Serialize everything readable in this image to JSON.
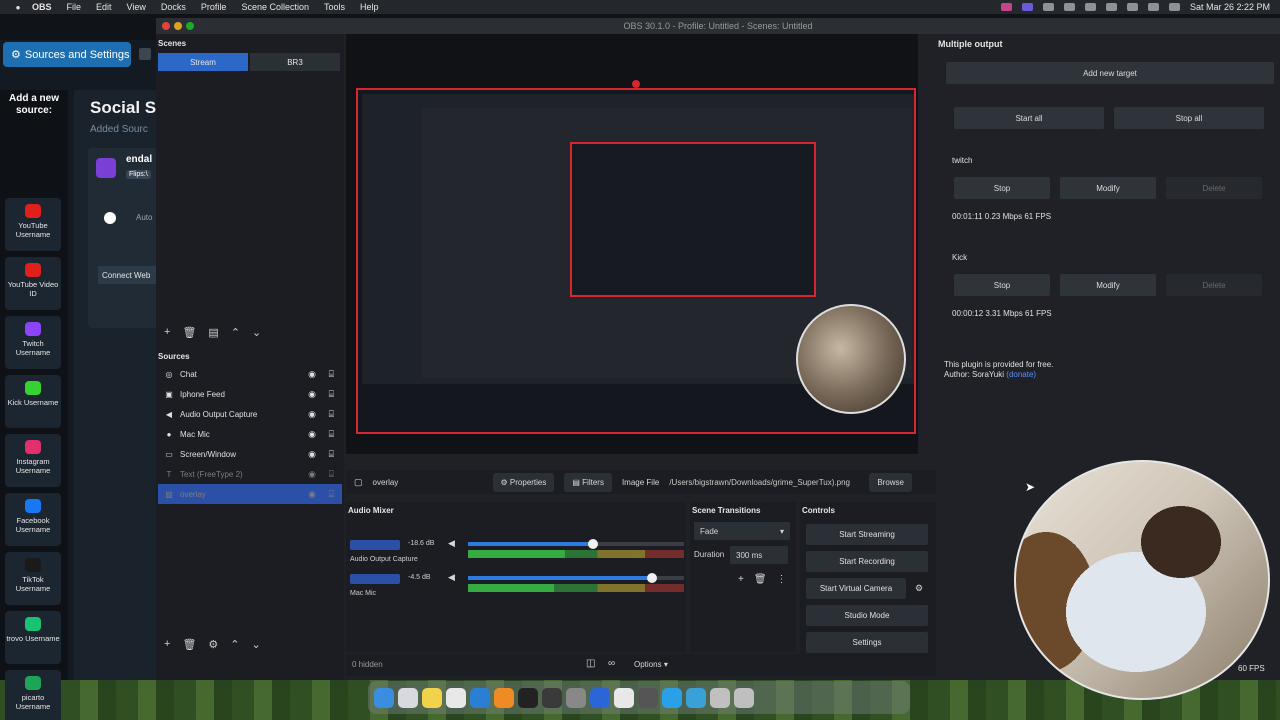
{
  "menubar": {
    "app": "OBS",
    "items": [
      "File",
      "Edit",
      "View",
      "Docks",
      "Profile",
      "Scene Collection",
      "Tools",
      "Help"
    ],
    "clock": "Sat Mar 26  2:22 PM"
  },
  "browser": {
    "tab_label": "Sources and Settings",
    "add_new_source": "Add a new source:",
    "rail": [
      {
        "label": "YouTube Username",
        "icon": "youtube-icon",
        "color": "#e0201c"
      },
      {
        "label": "YouTube Video ID",
        "icon": "youtube-icon",
        "color": "#e0201c"
      },
      {
        "label": "Twitch Username",
        "icon": "twitch-icon",
        "color": "#8b44f7"
      },
      {
        "label": "Kick Username",
        "icon": "kick-icon",
        "color": "#35d232"
      },
      {
        "label": "Instagram Username",
        "icon": "instagram-icon",
        "color": "#e1306c"
      },
      {
        "label": "Facebook Username",
        "icon": "facebook-icon",
        "color": "#1877f2"
      },
      {
        "label": "TikTok Username",
        "icon": "tiktok-icon",
        "color": "#1a1a1a"
      },
      {
        "label": "trovo Username",
        "icon": "trovo-icon",
        "color": "#19c273"
      },
      {
        "label": "picarto Username",
        "icon": "picarto-icon",
        "color": "#1da456"
      }
    ],
    "title": "Social St",
    "subtitle": "Added Sourc",
    "card_name": "endal",
    "card_pill": "Flips:\\",
    "card_auto": "Auto",
    "card_connect": "Connect Web"
  },
  "obs": {
    "window_title": "OBS 30.1.0 - Profile: Untitled - Scenes: Untitled",
    "scenes_header": "Scenes",
    "scenes": [
      "Stream",
      "BR3"
    ],
    "sources_header": "Sources",
    "sources": [
      {
        "name": "Chat",
        "icon": "globe-icon",
        "hidden": false,
        "selected": false
      },
      {
        "name": "Iphone Feed",
        "icon": "camera-icon",
        "hidden": false,
        "selected": false
      },
      {
        "name": "Audio Output Capture",
        "icon": "speaker-icon",
        "hidden": false,
        "selected": false
      },
      {
        "name": "Mac Mic",
        "icon": "mic-icon",
        "hidden": false,
        "selected": false
      },
      {
        "name": "Screen/Window",
        "icon": "monitor-icon",
        "hidden": false,
        "selected": false
      },
      {
        "name": "Text (FreeType 2)",
        "icon": "text-icon",
        "hidden": true,
        "selected": false
      },
      {
        "name": "overlay",
        "icon": "image-icon",
        "hidden": true,
        "selected": true
      }
    ],
    "source_toolbar": {
      "selected_source": "overlay",
      "properties": "Properties",
      "filters": "Filters",
      "image_file_label": "Image File",
      "image_path": "/Users/bigstrawn/Downloads/grime_SuperTux).png",
      "browse": "Browse"
    },
    "mixer": {
      "header": "Audio Mixer",
      "channels": [
        {
          "name": "Audio Output Capture",
          "db": "-18.6 dB",
          "volume": 0.58,
          "level": 0.45
        },
        {
          "name": "Mac Mic",
          "db": "-4.5 dB",
          "volume": 0.85,
          "level": 0.4
        }
      ],
      "footer_hidden": "0 hidden",
      "options": "Options"
    },
    "transitions": {
      "header": "Scene Transitions",
      "type": "Fade",
      "duration_label": "Duration",
      "duration": "300 ms"
    },
    "controls": {
      "header": "Controls",
      "buttons": [
        "Start Streaming",
        "Start Recording",
        "Start Virtual Camera",
        "Studio Mode",
        "Settings"
      ]
    },
    "multiple_output": {
      "header": "Multiple output",
      "add_target": "Add new target",
      "start_all": "Start all",
      "stop_all": "Stop all",
      "targets": [
        {
          "name": "twitch",
          "stop": "Stop",
          "modify": "Modify",
          "delete": "Delete",
          "stats": "00:01:11  0.23 Mbps  61 FPS"
        },
        {
          "name": "Kick",
          "stop": "Stop",
          "modify": "Modify",
          "delete": "Delete",
          "stats": "00:00:12  3.31 Mbps  61 FPS"
        }
      ],
      "note_line1": "This plugin is provided for free.",
      "note_line2": "Author: SoraYuki",
      "note_link": "(donate)"
    },
    "fps_tail": "60 FPS"
  },
  "colors": {
    "accent": "#2c68c7",
    "recording_red": "#d62630",
    "selected_row": "#2c4fa8"
  },
  "dock": {
    "icons": [
      "finder-icon",
      "launchpad-icon",
      "notes-icon",
      "chrome-icon",
      "vscode-icon",
      "sublime-icon",
      "terminal-icon",
      "obs-icon",
      "settings-icon",
      "xcode-icon",
      "chrome-icon",
      "tools-icon",
      "safari-icon",
      "sourcetree-icon",
      "app-icon",
      "trash-icon"
    ]
  }
}
